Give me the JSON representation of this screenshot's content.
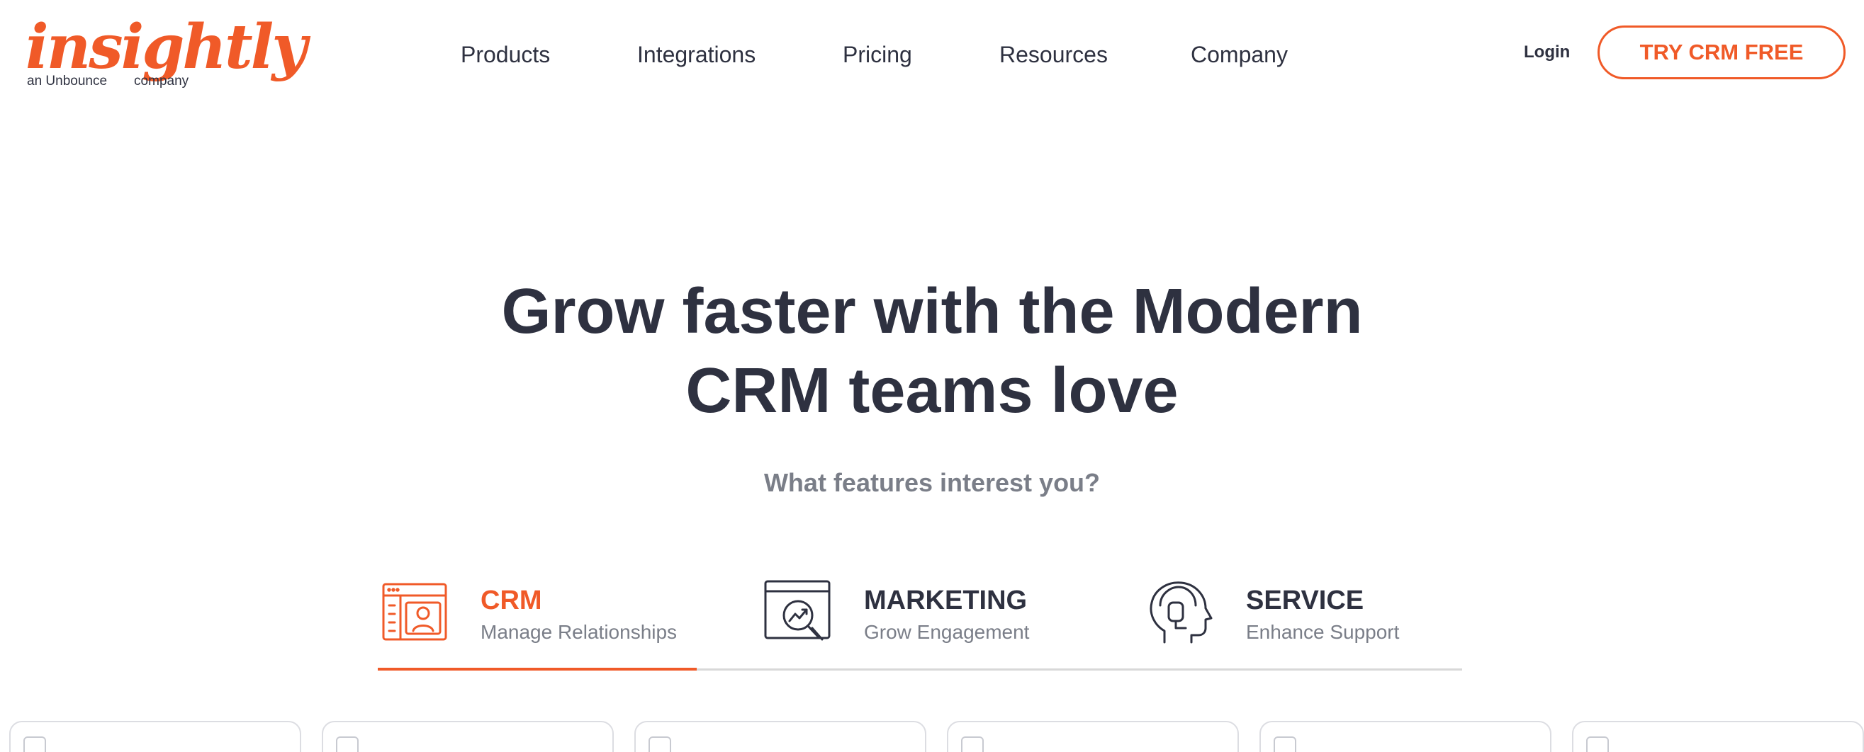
{
  "header": {
    "logo_text": "insightly",
    "logo_tagline_left": "an Unbounce",
    "logo_tagline_right": "company",
    "nav": [
      {
        "label": "Products"
      },
      {
        "label": "Integrations"
      },
      {
        "label": "Pricing"
      },
      {
        "label": "Resources"
      },
      {
        "label": "Company"
      }
    ],
    "login_label": "Login",
    "cta_label": "TRY CRM FREE"
  },
  "hero": {
    "title_line1": "Grow faster with the Modern",
    "title_line2": "CRM teams love",
    "subtitle": "What features interest you?"
  },
  "tabs": [
    {
      "title": "CRM",
      "description": "Manage Relationships",
      "icon": "crm-contact-card-icon",
      "active": true
    },
    {
      "title": "MARKETING",
      "description": "Grow Engagement",
      "icon": "marketing-analytics-icon",
      "active": false
    },
    {
      "title": "SERVICE",
      "description": "Enhance Support",
      "icon": "service-headset-icon",
      "active": false
    }
  ],
  "feature_cards": [
    {
      "checked": false
    },
    {
      "checked": false
    },
    {
      "checked": false
    },
    {
      "checked": false
    },
    {
      "checked": false
    },
    {
      "checked": false
    }
  ],
  "colors": {
    "accent": "#f05a28",
    "text_dark": "#2e3140",
    "text_muted": "#7a7e88",
    "divider": "#d8d8d8"
  }
}
